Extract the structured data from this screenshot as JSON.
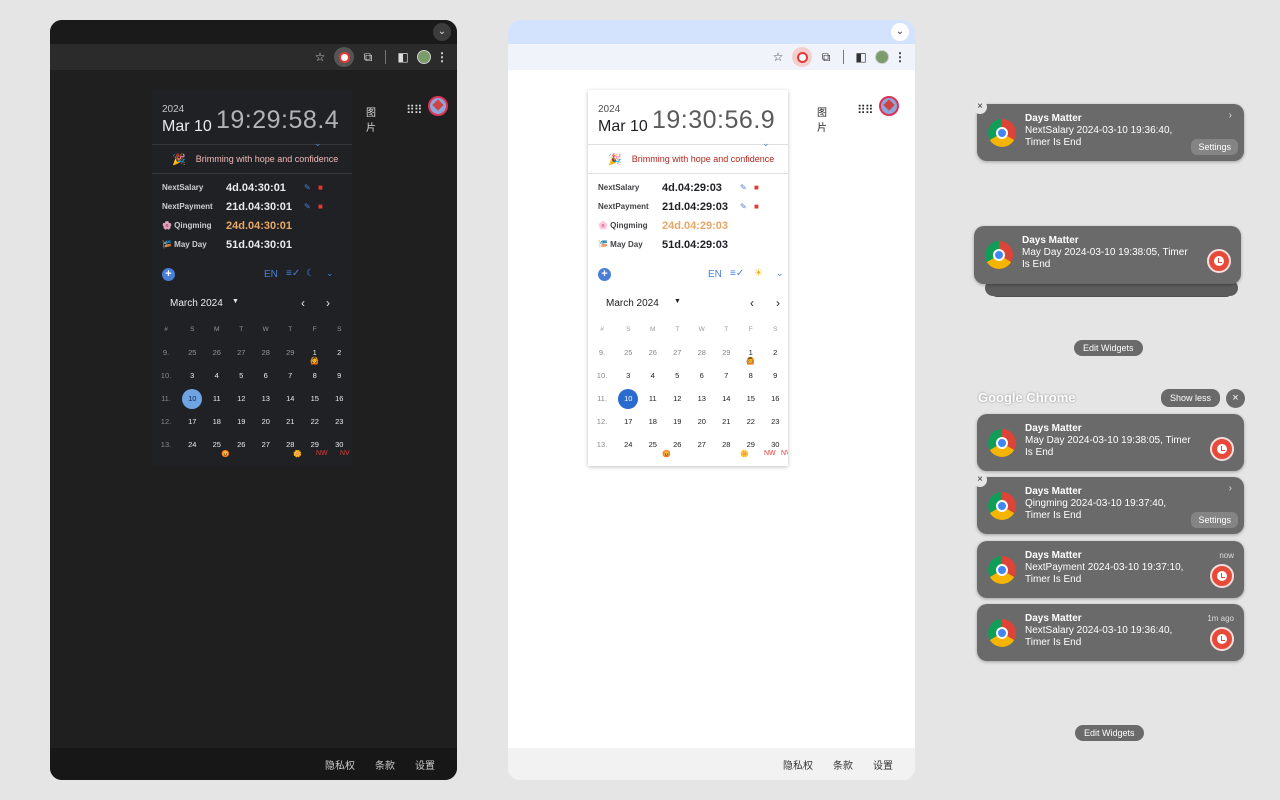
{
  "popup": {
    "year": "2024",
    "date": "Mar 10",
    "motto": "Brimming with hope and confidence",
    "motto_icon": "party-popper-icon",
    "lang": "EN"
  },
  "dark": {
    "time": "19:29:58.4",
    "events": [
      {
        "name": "NextSalary",
        "left": "4d.04:30:01",
        "editable": true
      },
      {
        "name": "NextPayment",
        "left": "21d.04:30:01",
        "editable": true
      },
      {
        "name": "🌸 Qingming",
        "left": "24d.04:30:01",
        "editable": false
      },
      {
        "name": "🎏 May Day",
        "left": "51d.04:30:01",
        "editable": false
      }
    ],
    "theme_icon": "☾"
  },
  "light": {
    "time": "19:30:56.9",
    "events": [
      {
        "name": "NextSalary",
        "left": "4d.04:29:03",
        "editable": true
      },
      {
        "name": "NextPayment",
        "left": "21d.04:29:03",
        "editable": true
      },
      {
        "name": "🌸 Qingming",
        "left": "24d.04:29:03",
        "editable": false
      },
      {
        "name": "🎏 May Day",
        "left": "51d.04:29:03",
        "editable": false
      }
    ],
    "theme_icon": "☀"
  },
  "calendar": {
    "month": "March 2024",
    "headers": [
      "#",
      "S",
      "M",
      "T",
      "W",
      "T",
      "F",
      "S"
    ],
    "weeks": [
      {
        "wk": "9.",
        "days": [
          [
            "25",
            1
          ],
          [
            "26",
            1
          ],
          [
            "27",
            1
          ],
          [
            "28",
            1
          ],
          [
            "29",
            1
          ],
          [
            "1",
            0
          ],
          [
            "2",
            0
          ]
        ]
      },
      {
        "wk": "10.",
        "days": [
          [
            "3",
            0
          ],
          [
            "4",
            0
          ],
          [
            "5",
            0
          ],
          [
            "6",
            0
          ],
          [
            "7",
            0
          ],
          [
            "8",
            0
          ],
          [
            "9",
            0
          ]
        ]
      },
      {
        "wk": "11.",
        "days": [
          [
            "10",
            2
          ],
          [
            "11",
            0
          ],
          [
            "12",
            0
          ],
          [
            "13",
            0
          ],
          [
            "14",
            0
          ],
          [
            "15",
            0
          ],
          [
            "16",
            0
          ]
        ]
      },
      {
        "wk": "12.",
        "days": [
          [
            "17",
            0
          ],
          [
            "18",
            0
          ],
          [
            "19",
            0
          ],
          [
            "20",
            0
          ],
          [
            "21",
            0
          ],
          [
            "22",
            0
          ],
          [
            "23",
            0
          ]
        ]
      },
      {
        "wk": "13.",
        "days": [
          [
            "24",
            0
          ],
          [
            "25",
            0
          ],
          [
            "26",
            0
          ],
          [
            "27",
            0
          ],
          [
            "28",
            0
          ],
          [
            "29",
            0
          ],
          [
            "30",
            0
          ]
        ]
      }
    ],
    "mark_day8": "🙆",
    "foot": [
      "😡",
      "🌼",
      "NW",
      "NV"
    ]
  },
  "browser": {
    "page_images": "图片",
    "footer": [
      "隐私权",
      "条款",
      "设置"
    ]
  },
  "notifications": {
    "app": "Days Matter",
    "group_title": "Google Chrome",
    "show_less": "Show less",
    "edit_widgets": "Edit Widgets",
    "settings": "Settings",
    "items": [
      {
        "body": "NextSalary 2024-03-10 19:36:40, Timer Is End",
        "time": ""
      },
      {
        "body": "May Day 2024-03-10 19:38:05, Timer Is End",
        "time": ""
      },
      {
        "body": "May Day 2024-03-10 19:38:05, Timer Is End",
        "time": ""
      },
      {
        "body": "Qingming 2024-03-10 19:37:40, Timer Is End",
        "time": ""
      },
      {
        "body": "NextPayment 2024-03-10 19:37:10, Timer Is End",
        "time": "now"
      },
      {
        "body": "NextSalary 2024-03-10 19:36:40, Timer Is End",
        "time": "1m ago"
      }
    ]
  }
}
